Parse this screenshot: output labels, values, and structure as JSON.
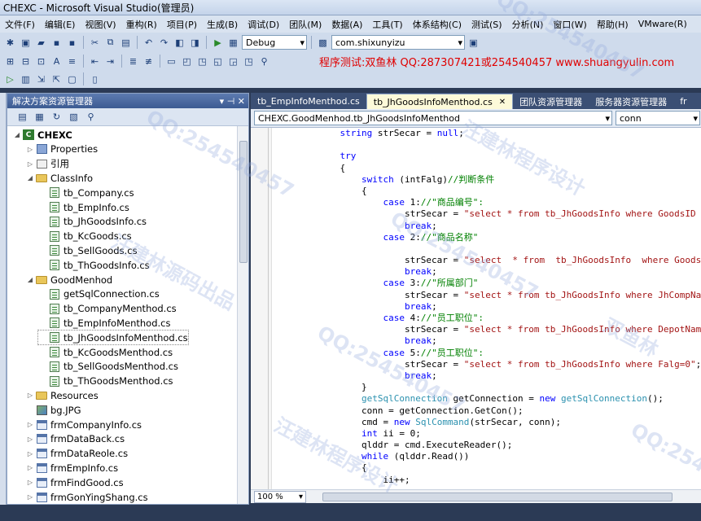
{
  "window": {
    "title": "CHEXC - Microsoft Visual Studio(管理员)"
  },
  "menu": [
    "文件(F)",
    "编辑(E)",
    "视图(V)",
    "重构(R)",
    "项目(P)",
    "生成(B)",
    "调试(D)",
    "团队(M)",
    "数据(A)",
    "工具(T)",
    "体系结构(C)",
    "测试(S)",
    "分析(N)",
    "窗口(W)",
    "帮助(H)",
    "VMware(R)"
  ],
  "toolbar": {
    "config": "Debug",
    "search": "com.shixunyizu"
  },
  "promo": "程序测试:双鱼林 QQ:287307421或254540457 www.shuangyulin.com",
  "solution": {
    "title": "解决方案资源管理器",
    "pin": "▾ ⊣ ✕",
    "items": [
      {
        "label": "CHEXC",
        "kind": "proj"
      },
      {
        "label": "Properties",
        "kind": "prop"
      },
      {
        "label": "引用",
        "kind": "ref"
      },
      {
        "label": "ClassInfo",
        "kind": "folder"
      },
      {
        "label": "tb_Company.cs",
        "kind": "cs"
      },
      {
        "label": "tb_EmpInfo.cs",
        "kind": "cs"
      },
      {
        "label": "tb_JhGoodsInfo.cs",
        "kind": "cs"
      },
      {
        "label": "tb_KcGoods.cs",
        "kind": "cs"
      },
      {
        "label": "tb_SellGoods.cs",
        "kind": "cs"
      },
      {
        "label": "tb_ThGoodsInfo.cs",
        "kind": "cs"
      },
      {
        "label": "GoodMenhod",
        "kind": "folder"
      },
      {
        "label": "getSqlConnection.cs",
        "kind": "cs"
      },
      {
        "label": "tb_CompanyMenthod.cs",
        "kind": "cs"
      },
      {
        "label": "tb_EmpInfoMenthod.cs",
        "kind": "cs"
      },
      {
        "label": "tb_JhGoodsInfoMenthod.cs",
        "kind": "cs"
      },
      {
        "label": "tb_KcGoodsMenthod.cs",
        "kind": "cs"
      },
      {
        "label": "tb_SellGoodsMenthod.cs",
        "kind": "cs"
      },
      {
        "label": "tb_ThGoodsMenthod.cs",
        "kind": "cs"
      },
      {
        "label": "Resources",
        "kind": "folder"
      },
      {
        "label": "bg.JPG",
        "kind": "img"
      },
      {
        "label": "frmCompanyInfo.cs",
        "kind": "form"
      },
      {
        "label": "frmDataBack.cs",
        "kind": "form"
      },
      {
        "label": "frmDataReole.cs",
        "kind": "form"
      },
      {
        "label": "frmEmpInfo.cs",
        "kind": "form"
      },
      {
        "label": "frmFindGood.cs",
        "kind": "form"
      },
      {
        "label": "frmGonYingShang.cs",
        "kind": "form"
      }
    ]
  },
  "tabs": [
    {
      "label": "tb_EmpInfoMenthod.cs",
      "active": false
    },
    {
      "label": "tb_JhGoodsInfoMenthod.cs",
      "active": true
    },
    {
      "label": "团队资源管理器",
      "active": false
    },
    {
      "label": "服务器资源管理器",
      "active": false
    },
    {
      "label": "fr",
      "active": false
    }
  ],
  "nav": {
    "type": "CHEXC.GoodMenhod.tb_JhGoodsInfoMenthod",
    "member": "conn"
  },
  "zoom": "100 %",
  "code": [
    [
      [
        "            ",
        ""
      ],
      [
        "string",
        "kw"
      ],
      [
        " strSecar = ",
        ""
      ],
      [
        "null",
        "kw"
      ],
      [
        ";",
        ""
      ]
    ],
    [
      [
        "",
        ""
      ]
    ],
    [
      [
        "            ",
        ""
      ],
      [
        "try",
        "kw"
      ]
    ],
    [
      [
        "            {",
        ""
      ]
    ],
    [
      [
        "                ",
        ""
      ],
      [
        "switch",
        "kw"
      ],
      [
        " (intFalg)",
        ""
      ],
      [
        "//判断条件",
        "cm"
      ]
    ],
    [
      [
        "                {",
        ""
      ]
    ],
    [
      [
        "                    ",
        ""
      ],
      [
        "case",
        "kw"
      ],
      [
        " 1:",
        ""
      ],
      [
        "//\"商品编号\":",
        "cm"
      ]
    ],
    [
      [
        "                        strSecar = ",
        ""
      ],
      [
        "\"select * from tb_JhGoodsInfo where GoodsID like",
        "str"
      ]
    ],
    [
      [
        "                        ",
        ""
      ],
      [
        "break",
        "kw"
      ],
      [
        ";",
        ""
      ]
    ],
    [
      [
        "                    ",
        ""
      ],
      [
        "case",
        "kw"
      ],
      [
        " 2:",
        ""
      ],
      [
        "//\"商品名称\"",
        "cm"
      ]
    ],
    [
      [
        "",
        ""
      ]
    ],
    [
      [
        "                        strSecar = ",
        ""
      ],
      [
        "\"select  * from  tb_JhGoodsInfo  where GoodsName",
        "str"
      ]
    ],
    [
      [
        "                        ",
        ""
      ],
      [
        "break",
        "kw"
      ],
      [
        ";",
        ""
      ]
    ],
    [
      [
        "                    ",
        ""
      ],
      [
        "case",
        "kw"
      ],
      [
        " 3:",
        ""
      ],
      [
        "//\"所属部门\"",
        "cm"
      ]
    ],
    [
      [
        "                        strSecar = ",
        ""
      ],
      [
        "\"select * from tb_JhGoodsInfo where JhCompName li",
        "str"
      ]
    ],
    [
      [
        "                        ",
        ""
      ],
      [
        "break",
        "kw"
      ],
      [
        ";",
        ""
      ]
    ],
    [
      [
        "                    ",
        ""
      ],
      [
        "case",
        "kw"
      ],
      [
        " 4:",
        ""
      ],
      [
        "//\"员工职位\":",
        "cm"
      ]
    ],
    [
      [
        "                        strSecar = ",
        ""
      ],
      [
        "\"select * from tb_JhGoodsInfo where DepotName lik",
        "str"
      ]
    ],
    [
      [
        "                        ",
        ""
      ],
      [
        "break",
        "kw"
      ],
      [
        ";",
        ""
      ]
    ],
    [
      [
        "                    ",
        ""
      ],
      [
        "case",
        "kw"
      ],
      [
        " 5:",
        ""
      ],
      [
        "//\"员工职位\":",
        "cm"
      ]
    ],
    [
      [
        "                        strSecar = ",
        ""
      ],
      [
        "\"select * from tb_JhGoodsInfo where Falg=0\"",
        "str"
      ],
      [
        ";",
        ""
      ]
    ],
    [
      [
        "                        ",
        ""
      ],
      [
        "break",
        "kw"
      ],
      [
        ";",
        ""
      ]
    ],
    [
      [
        "                }",
        ""
      ]
    ],
    [
      [
        "                ",
        ""
      ],
      [
        "getSqlConnection",
        "ty"
      ],
      [
        " getConnection = ",
        ""
      ],
      [
        "new",
        "kw"
      ],
      [
        " ",
        ""
      ],
      [
        "getSqlConnection",
        "ty"
      ],
      [
        "();",
        ""
      ]
    ],
    [
      [
        "                conn = getConnection.GetCon();",
        ""
      ]
    ],
    [
      [
        "                cmd = ",
        ""
      ],
      [
        "new",
        "kw"
      ],
      [
        " ",
        ""
      ],
      [
        "SqlCommand",
        "ty"
      ],
      [
        "(strSecar, conn);",
        ""
      ]
    ],
    [
      [
        "                ",
        ""
      ],
      [
        "int",
        "kw"
      ],
      [
        " ii = 0;",
        ""
      ]
    ],
    [
      [
        "                qlddr = cmd.ExecuteReader();",
        ""
      ]
    ],
    [
      [
        "                ",
        ""
      ],
      [
        "while",
        "kw"
      ],
      [
        " (qlddr.Read())",
        ""
      ]
    ],
    [
      [
        "                {",
        ""
      ]
    ],
    [
      [
        "                    ii++;",
        ""
      ]
    ]
  ],
  "watermarks": [
    "QQ:254540457",
    "汪建林程序设计",
    "汪建林源码出品",
    "双鱼林",
    "QQ:2545"
  ]
}
